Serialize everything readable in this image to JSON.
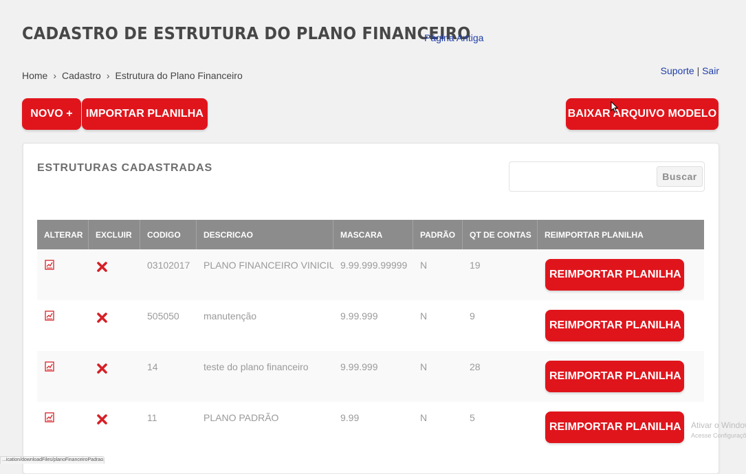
{
  "header": {
    "title": "CADASTRO DE ESTRUTURA DO PLANO FINANCEIRO",
    "old_page_link": "Página Antiga"
  },
  "breadcrumb": {
    "items": [
      "Home",
      "Cadastro",
      "Estrutura do Plano Financeiro"
    ],
    "separator": "›"
  },
  "top_links": {
    "support": "Suporte",
    "divider": "|",
    "logout": "Sair"
  },
  "toolbar": {
    "new_label": "NOVO +",
    "import_label": "IMPORTAR PLANILHA",
    "download_label": "BAIXAR ARQUIVO MODELO"
  },
  "panel": {
    "title": "ESTRUTURAS CADASTRADAS",
    "search": {
      "placeholder": "",
      "button_label": "Buscar"
    }
  },
  "table": {
    "headers": [
      "ALTERAR",
      "EXCLUIR",
      "CODIGO",
      "DESCRICAO",
      "MASCARA",
      "PADRÃO",
      "QT DE CONTAS",
      "REIMPORTAR PLANILHA"
    ],
    "rows": [
      {
        "codigo": "03102017",
        "descricao": "PLANO FINANCEIRO VINICIUS",
        "mascara": "9.99.999.99999",
        "padrao": "N",
        "qt_contas": "19",
        "action_label": "REIMPORTAR PLANILHA"
      },
      {
        "codigo": "505050",
        "descricao": "manutenção",
        "mascara": "9.99.999",
        "padrao": "N",
        "qt_contas": "9",
        "action_label": "REIMPORTAR PLANILHA"
      },
      {
        "codigo": "14",
        "descricao": "teste do plano financeiro",
        "mascara": "9.99.999",
        "padrao": "N",
        "qt_contas": "28",
        "action_label": "REIMPORTAR PLANILHA"
      },
      {
        "codigo": "11",
        "descricao": "PLANO PADRÃO",
        "mascara": "9.99",
        "padrao": "N",
        "qt_contas": "5",
        "action_label": "REIMPORTAR PLANILHA"
      }
    ]
  },
  "watermark": {
    "line1": "Ativar o Window",
    "line2": "Acesse Configurações"
  },
  "status_bar": {
    "url": "...ication/downloadFiles/planoFinanceiroPadrao.xlsx"
  },
  "colors": {
    "accent_red": "#e0151c",
    "table_header": "#8c8c8c",
    "link_blue": "#1f3ea8"
  },
  "icons": {
    "edit": "edit-document-icon",
    "delete": "delete-x-icon",
    "cursor": "mouse-cursor-icon"
  }
}
